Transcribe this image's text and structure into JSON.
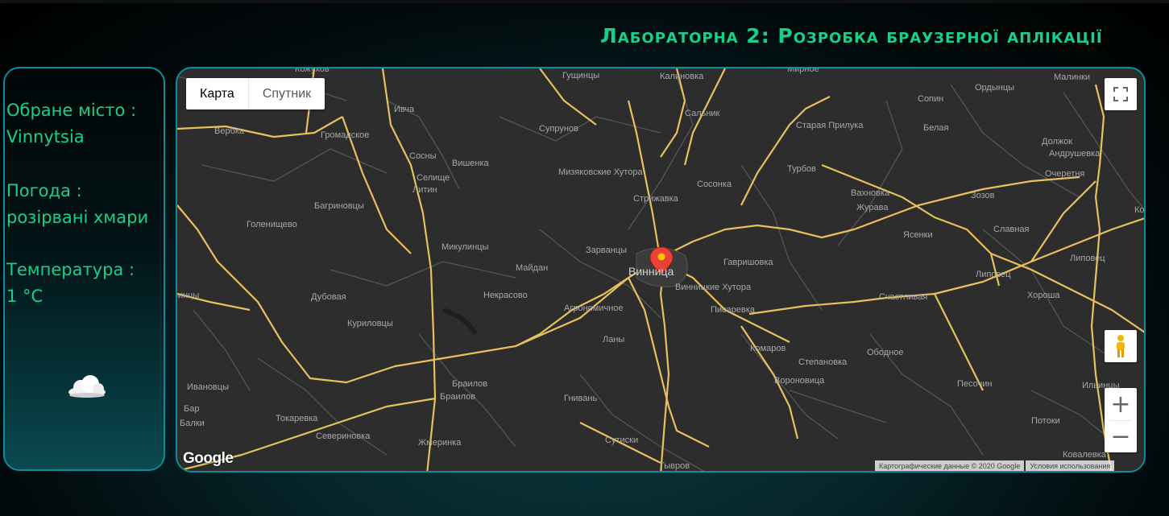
{
  "page": {
    "title": "Лабораторна 2: Розробка браузерної аплікації"
  },
  "info_panel": {
    "city_label": "Обране місто :",
    "city_value": "Vinnytsia",
    "weather_label": "Погода :",
    "weather_value": "розірвані хмари",
    "temp_label": "Температура :",
    "temp_value": "1 °C",
    "weather_icon": "cloud-icon"
  },
  "map": {
    "map_type_active": "Карта",
    "map_type_inactive": "Спутник",
    "fullscreen_icon": "fullscreen-icon",
    "pegman_icon": "pegman-icon",
    "zoom_in": "+",
    "zoom_out": "−",
    "logo": "Google",
    "attribution": "Картографические данные © 2020 Google",
    "terms": "Условия использования",
    "marker_city": "Винница",
    "road_color": "#e8c15e",
    "background_color": "#2d2d2d",
    "marker_color": "#ea4335",
    "places": [
      "Кожухов",
      "Гущинцы",
      "Калиновка",
      "Мирное",
      "Малинки",
      "Ордынцы",
      "Ивча",
      "Сальник",
      "Сопин",
      "Вербка",
      "Громадское",
      "Супрунов",
      "Старая Прилука",
      "Белая",
      "Должок",
      "Андрушевка",
      "Сосны",
      "Вишенка",
      "Мизяковские Хутора",
      "Турбов",
      "Очеретня",
      "Селище",
      "Литин",
      "Сосонка",
      "Стрижавка",
      "Вахновка",
      "Зозов",
      "Журава",
      "Кожанка",
      "Голенищево",
      "Багриновцы",
      "Ясенки",
      "Славная",
      "Микулинцы",
      "Зарванцы",
      "Гавришовка",
      "Липовец",
      "Майдан",
      "Винница",
      "Липовец",
      "Винницкие Хутора",
      "Счастливая",
      "Хороша",
      "винцы",
      "Дубовая",
      "Некрасово",
      "Агрономичное",
      "Писаревка",
      "Куриловцы",
      "Ланы",
      "Комаров",
      "Ободное",
      "Степановка",
      "Ивановцы",
      "Браилов",
      "Браилов",
      "Гнивань",
      "Вороновица",
      "Песочин",
      "Ильинцы",
      "Бар",
      "Балки",
      "Токаревка",
      "Севериновка",
      "Жмеринка",
      "Сутиски",
      "Потоки",
      "Ковалевка",
      "Тывров"
    ]
  }
}
